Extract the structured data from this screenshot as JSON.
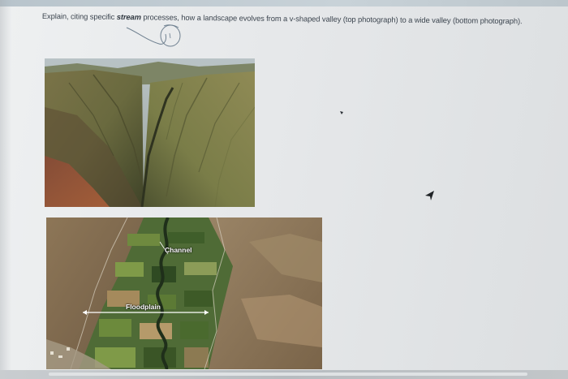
{
  "question": {
    "prefix": "Explain, citing specific ",
    "emphasis": "stream",
    "suffix": " processes, how a landscape evolves from a v-shaped valley (top photograph) to a wide valley (bottom photograph)."
  },
  "photos": {
    "top": {},
    "bottom": {
      "channel_label": "Channel",
      "floodplain_label": "Floodplain"
    }
  },
  "icons": {
    "cursor": "mouse-pointer-icon",
    "scribble": "pen-scribble-icon"
  },
  "colors": {
    "text": "#3d4650",
    "label": "#ffffff"
  }
}
